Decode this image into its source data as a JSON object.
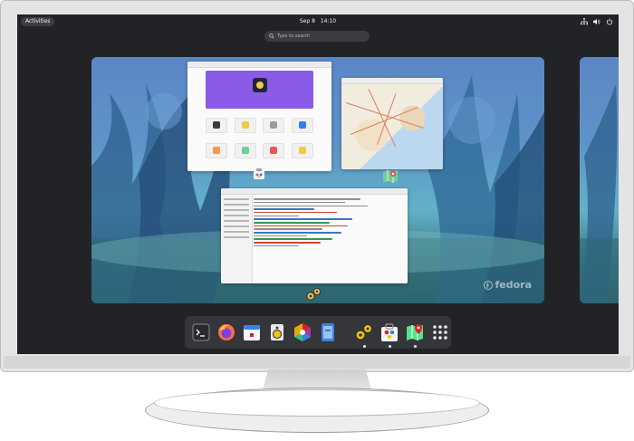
{
  "topbar": {
    "activities_label": "Activities",
    "date": "Sep 8",
    "time": "14:10",
    "tray_icons": [
      "network-icon",
      "volume-icon",
      "power-icon"
    ]
  },
  "search": {
    "placeholder": "Type to search"
  },
  "wallpaper": {
    "brand_text": "fedora"
  },
  "windows": [
    {
      "name": "software",
      "icon": "software-icon"
    },
    {
      "name": "maps",
      "icon": "maps-icon"
    },
    {
      "name": "builder",
      "icon": "builder-icon"
    }
  ],
  "dock": {
    "items": [
      {
        "name": "terminal",
        "icon": "terminal-icon",
        "running": false
      },
      {
        "name": "firefox",
        "icon": "firefox-icon",
        "running": false
      },
      {
        "name": "calendar",
        "icon": "calendar-icon",
        "running": false
      },
      {
        "name": "rhythmbox",
        "icon": "speaker-icon",
        "running": false
      },
      {
        "name": "photos",
        "icon": "photos-icon",
        "running": false
      },
      {
        "name": "files",
        "icon": "files-icon",
        "running": false
      },
      {
        "name": "builder",
        "icon": "builder-icon",
        "running": true
      },
      {
        "name": "software",
        "icon": "software-icon",
        "running": true
      },
      {
        "name": "maps",
        "icon": "maps-icon",
        "running": true
      },
      {
        "name": "app-grid",
        "icon": "app-grid-icon",
        "running": false
      }
    ]
  },
  "colors": {
    "panel": "#222326",
    "dock": "#353639",
    "accent_purple": "#8a5be6",
    "wallpaper_blue": "#5e93c9",
    "wallpaper_teal": "#62b2c7"
  }
}
